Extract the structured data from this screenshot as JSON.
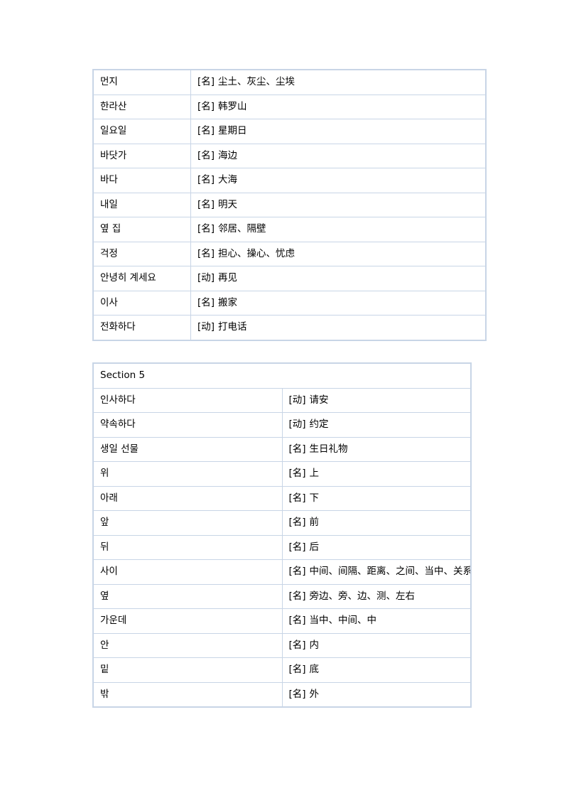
{
  "page": {
    "background_color": "#ffffff",
    "border_color": "#c8d5e6",
    "section_heading_color": "#2222dd",
    "text_color": "#000000"
  },
  "tables": [
    {
      "id": "table-1",
      "section_label": null,
      "rows": [
        {
          "term": "먼지",
          "pos": "[名]",
          "definition": "尘土、灰尘、尘埃"
        },
        {
          "term": "한라산",
          "pos": "[名]",
          "definition": "韩罗山"
        },
        {
          "term": "일요일",
          "pos": "[名]",
          "definition": "星期日"
        },
        {
          "term": "바닷가",
          "pos": "[名]",
          "definition": "海边"
        },
        {
          "term": "바다",
          "pos": "[名]",
          "definition": "大海"
        },
        {
          "term": "내일",
          "pos": "[名]",
          "definition": "明天"
        },
        {
          "term": "옆 집",
          "pos": "[名]",
          "definition": "邻居、隔壁"
        },
        {
          "term": "걱정",
          "pos": "[名]",
          "definition": "担心、操心、忧虑"
        },
        {
          "term": "안녕히 계세요",
          "pos": "[动]",
          "definition": "再见"
        },
        {
          "term": "이사",
          "pos": "[名]",
          "definition": "搬家"
        },
        {
          "term": "전화하다",
          "pos": "[动]",
          "definition": "打电话"
        }
      ]
    },
    {
      "id": "table-2",
      "section_label": "Section 5",
      "rows": [
        {
          "term": "인사하다",
          "pos": "[动]",
          "definition": "请安"
        },
        {
          "term": "약속하다",
          "pos": "[动]",
          "definition": "约定"
        },
        {
          "term": "생일 선물",
          "pos": "[名]",
          "definition": "生日礼物"
        },
        {
          "term": "위",
          "pos": "[名]",
          "definition": "上"
        },
        {
          "term": "아래",
          "pos": "[名]",
          "definition": "下"
        },
        {
          "term": "앞",
          "pos": "[名]",
          "definition": "前"
        },
        {
          "term": "뒤",
          "pos": "[名]",
          "definition": "后"
        },
        {
          "term": "사이",
          "pos": "[名]",
          "definition": "中间、间隔、距离、之间、当中、关系"
        },
        {
          "term": "옆",
          "pos": "[名]",
          "definition": "旁边、旁、边、测、左右"
        },
        {
          "term": "가운데",
          "pos": "[名]",
          "definition": "当中、中间、中"
        },
        {
          "term": "안",
          "pos": "[名]",
          "definition": "内"
        },
        {
          "term": "밑",
          "pos": "[名]",
          "definition": "底"
        },
        {
          "term": "밖",
          "pos": "[名]",
          "definition": "外"
        }
      ]
    }
  ]
}
